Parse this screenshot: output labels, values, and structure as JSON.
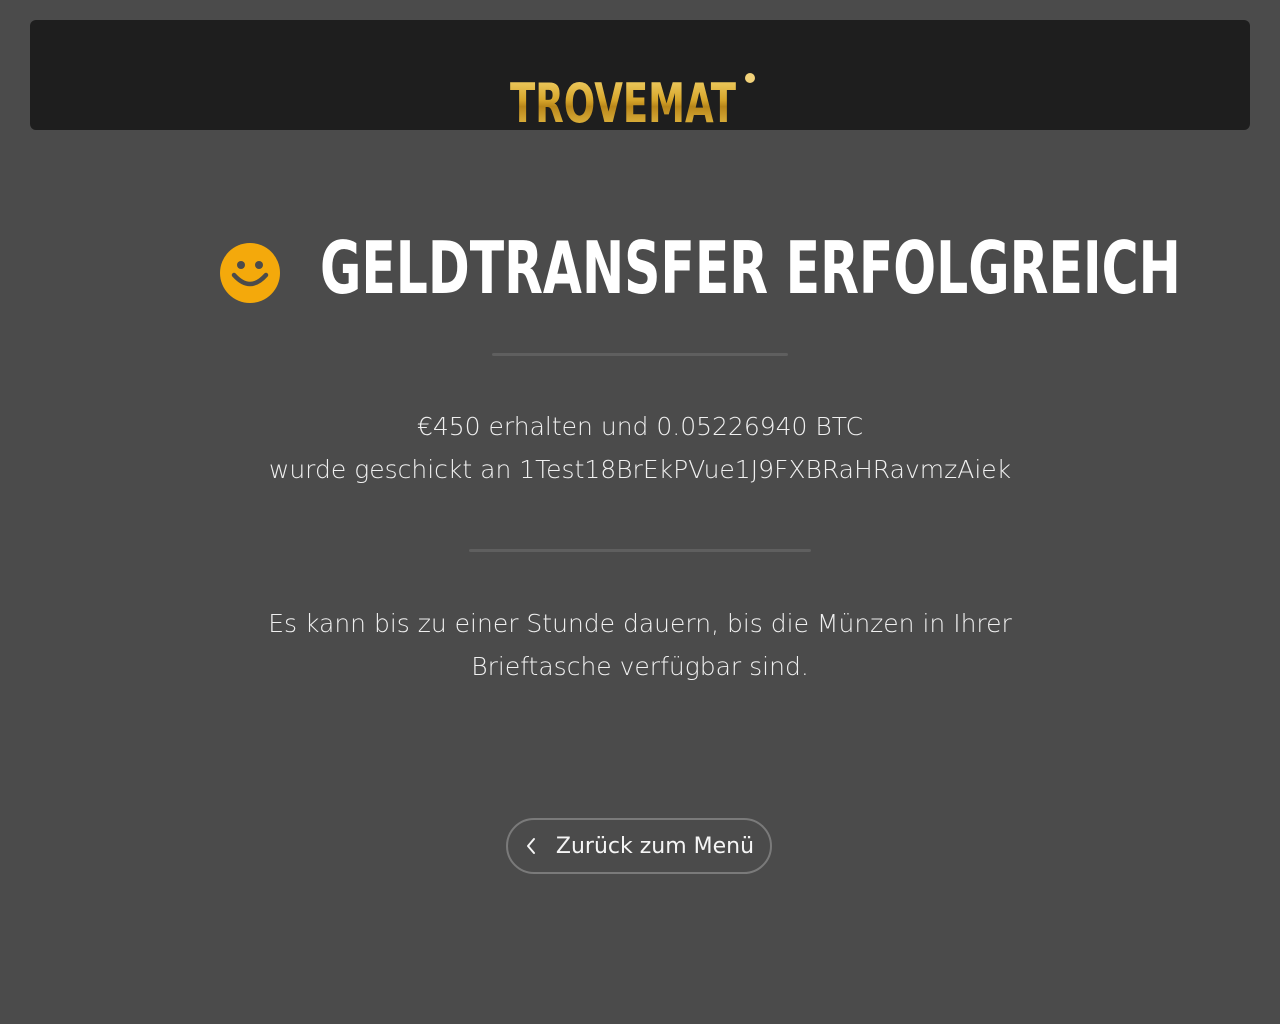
{
  "header": {
    "logo_text": "TROVEMAT"
  },
  "status": {
    "icon": "smiley-icon",
    "icon_color": "#f4a90b",
    "title": "GELDTRANSFER ERFOLGREICH"
  },
  "transaction": {
    "line1": "€450 erhalten und 0.05226940 BTC",
    "line2": "wurde geschickt an 1Test18BrEkPVue1J9FXBRaHRavmzAiek"
  },
  "notice": {
    "line1": "Es kann bis zu einer Stunde dauern, bis die Münzen in Ihrer",
    "line2": "Brieftasche verfügbar sind."
  },
  "actions": {
    "back_label": "Zurück zum Menü",
    "back_icon": "chevron-left-icon"
  },
  "colors": {
    "background": "#4b4b4b",
    "header_bg": "#1e1e1e",
    "logo_gold": "#d4a52a",
    "smiley": "#f4a90b"
  }
}
